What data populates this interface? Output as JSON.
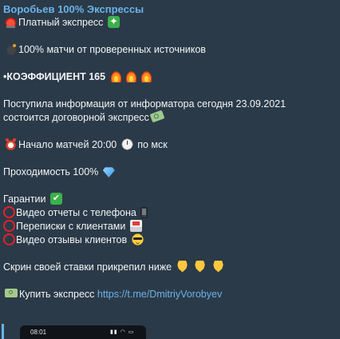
{
  "message": {
    "sender": "Воробьев 100% Экспрессы",
    "lines": {
      "paid": "Платный экспресс",
      "matches": "100% матчи от проверенных источников",
      "coefficient": "•КОЭФФИЦИЕНТ 165",
      "info_1": "Поступила информация от информатора сегодня 23.09.2021",
      "info_2": "состоится договорной экспресс",
      "start": "Начало матчей 20:00",
      "start_suffix": "по мск",
      "pass_rate": "Проходимость 100%",
      "guarantees": "Гарантии",
      "g_video_phone": "Видео отчеты с телефона",
      "g_chats": "Переписки с клиентами",
      "g_reviews": "Видео отзывы клиентов",
      "screenshot": "Скрин своей ставки прикрепил ниже",
      "buy": "Купить экспресс",
      "buy_link": "https://t.me/DmitriyVorobyev"
    },
    "icons": {
      "siren": "police-car-light-icon",
      "sparkle": "sparkle-icon",
      "bomb": "bomb-icon",
      "fire": "fire-icon",
      "money_wings": "money-with-wings-icon",
      "alarm": "alarm-clock-icon",
      "clock": "clock-icon",
      "diamond": "gem-stone-icon",
      "check": "check-mark-button-icon",
      "ring": "hollow-red-circle-icon",
      "phone": "mobile-phone-icon",
      "inbox": "inbox-tray-icon",
      "cool": "smiling-face-with-sunglasses-icon",
      "point_down": "backhand-index-pointing-down-icon",
      "banknote": "dollar-banknote-icon"
    }
  },
  "attachment": {
    "status_time": "08:01"
  },
  "colors": {
    "background": "#182533",
    "bubble": "#2b3a48",
    "sender": "#6cb2e8",
    "link": "#6cb2e8",
    "text": "#f2f4f6"
  }
}
